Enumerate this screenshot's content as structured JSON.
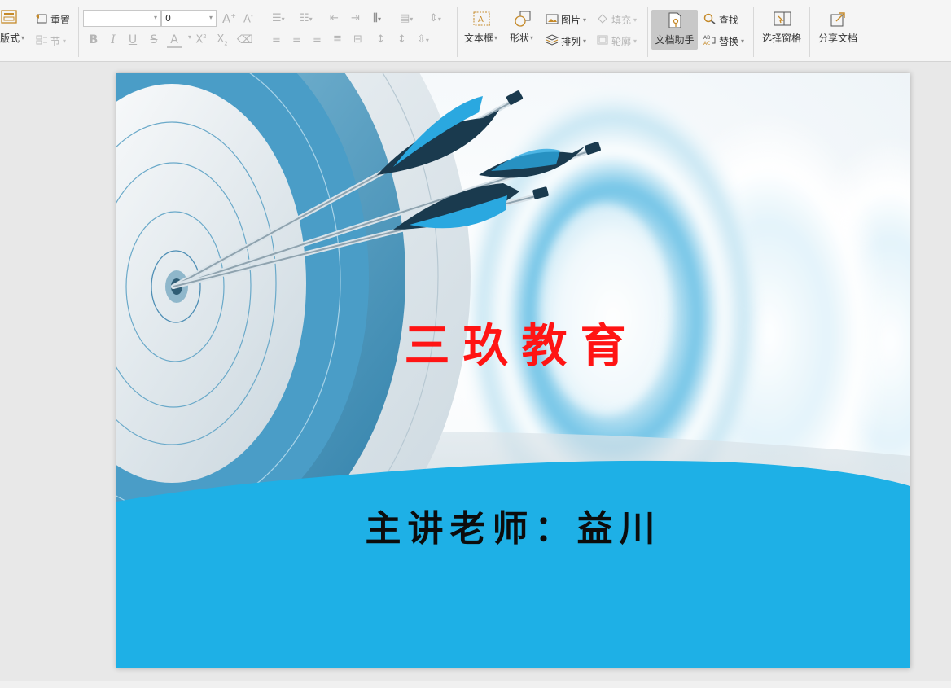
{
  "ribbon": {
    "layout_label": "版式",
    "reset_label": "重置",
    "section_label": "节",
    "font_size_value": "0",
    "textbox_label": "文本框",
    "shape_label": "形状",
    "picture_label": "图片",
    "arrange_label": "排列",
    "fill_label": "填充",
    "outline_label": "轮廓",
    "doc_assistant_label": "文档助手",
    "find_label": "查找",
    "replace_label": "替换",
    "selection_pane_label": "选择窗格",
    "share_doc_label": "分享文档"
  },
  "slide": {
    "title": "三玖教育",
    "speaker": "主讲老师：益川",
    "colors": {
      "title": "#ff1414",
      "band": "#1eb0e6",
      "speaker": "#0c0c0c"
    }
  }
}
